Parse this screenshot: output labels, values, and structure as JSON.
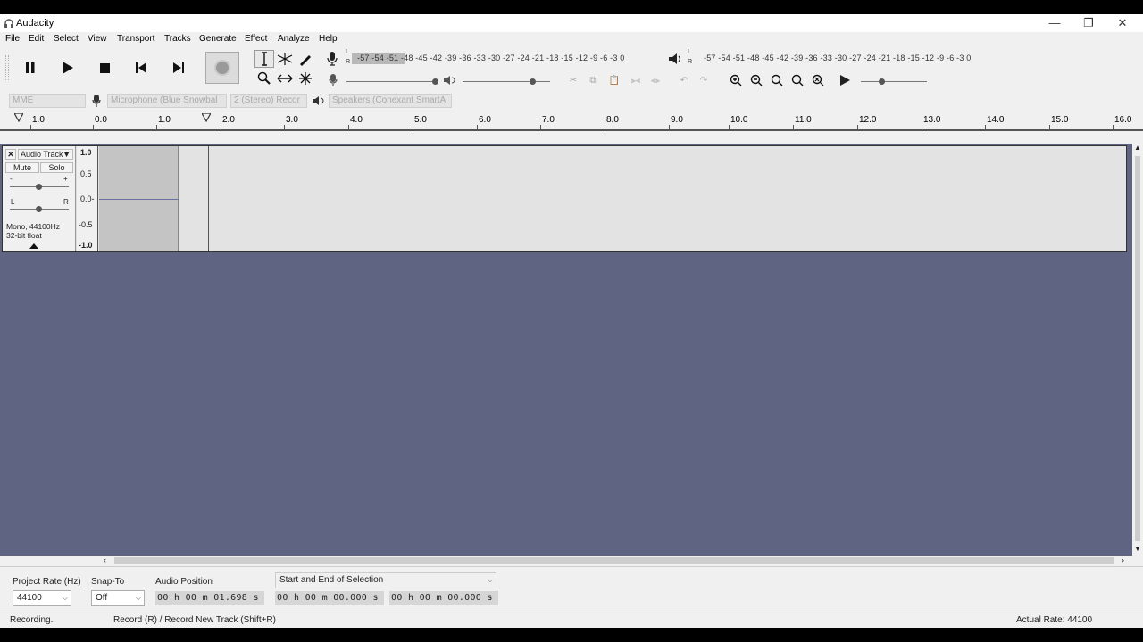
{
  "window": {
    "title": "Audacity"
  },
  "menu": [
    "File",
    "Edit",
    "Select",
    "View",
    "Transport",
    "Tracks",
    "Generate",
    "Effect",
    "Analyze",
    "Help"
  ],
  "meters": {
    "record_scale": "-57 -54 -51 -48 -45 -42 -39 -36 -33 -30 -27 -24 -21 -18 -15 -12  -9  -6  -3  0",
    "playback_scale": "-57 -54 -51 -48 -45 -42 -39 -36 -33 -30 -27 -24 -21 -18 -15 -12  -9  -6  -3  0",
    "record_level_fraction": 0.3,
    "channel_left": "L",
    "channel_right": "R"
  },
  "devices": {
    "host": "MME",
    "input": "Microphone (Blue Snowbal",
    "channels": "2 (Stereo) Recor",
    "output": "Speakers (Conexant SmartA"
  },
  "ruler": {
    "ticks": [
      "1.0",
      "0.0",
      "1.0",
      "2.0",
      "3.0",
      "4.0",
      "5.0",
      "6.0",
      "7.0",
      "8.0",
      "9.0",
      "10.0",
      "11.0",
      "12.0",
      "13.0",
      "14.0",
      "15.0",
      "16.0"
    ]
  },
  "track": {
    "name": "Audio Track",
    "mute": "Mute",
    "solo": "Solo",
    "gain_minus": "-",
    "gain_plus": "+",
    "pan_left": "L",
    "pan_right": "R",
    "info_line1": "Mono, 44100Hz",
    "info_line2": "32-bit float",
    "scale": [
      "1.0",
      "0.5",
      "0.0-",
      "-0.5",
      "-1.0"
    ]
  },
  "selection_toolbar": {
    "project_rate_label": "Project Rate (Hz)",
    "project_rate": "44100",
    "snap_to_label": "Snap-To",
    "snap_to": "Off",
    "audio_position_label": "Audio Position",
    "audio_position": "00 h 00 m 01.698 s",
    "selection_mode": "Start and End of Selection",
    "selection_start": "00 h 00 m 00.000 s",
    "selection_end": "00 h 00 m 00.000 s"
  },
  "status": {
    "state": "Recording.",
    "hint": "Record (R) / Record New Track (Shift+R)",
    "actual_rate": "Actual Rate: 44100"
  },
  "colors": {
    "track_area_bg": "#5e6482",
    "window_bg": "#f0f0f0"
  }
}
